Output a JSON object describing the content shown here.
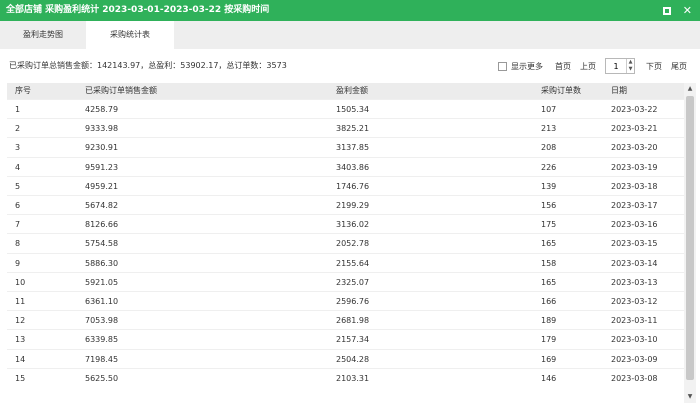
{
  "window": {
    "title": "全部店铺 采购盈利统计 2023-03-01-2023-03-22 按采购时间",
    "max_icon": "maximize-icon",
    "close_icon": "close-icon",
    "close_glyph": "✕"
  },
  "tabs": [
    {
      "label": "盈利走势图",
      "active": false
    },
    {
      "label": "采购统计表",
      "active": true
    }
  ],
  "summary": "已采购订单总销售金额：142143.97，总盈利：53902.17，总订单数：3573",
  "pager": {
    "show_more_label": "显示更多",
    "first_label": "首页",
    "prev_label": "上页",
    "page_value": "1",
    "next_label": "下页",
    "last_label": "尾页"
  },
  "table": {
    "columns": [
      "序号",
      "已采购订单销售金额",
      "盈利金额",
      "采购订单数",
      "日期"
    ],
    "rows": [
      [
        "1",
        "4258.79",
        "1505.34",
        "107",
        "2023-03-22"
      ],
      [
        "2",
        "9333.98",
        "3825.21",
        "213",
        "2023-03-21"
      ],
      [
        "3",
        "9230.91",
        "3137.85",
        "208",
        "2023-03-20"
      ],
      [
        "4",
        "9591.23",
        "3403.86",
        "226",
        "2023-03-19"
      ],
      [
        "5",
        "4959.21",
        "1746.76",
        "139",
        "2023-03-18"
      ],
      [
        "6",
        "5674.82",
        "2199.29",
        "156",
        "2023-03-17"
      ],
      [
        "7",
        "8126.66",
        "3136.02",
        "175",
        "2023-03-16"
      ],
      [
        "8",
        "5754.58",
        "2052.78",
        "165",
        "2023-03-15"
      ],
      [
        "9",
        "5886.30",
        "2155.64",
        "158",
        "2023-03-14"
      ],
      [
        "10",
        "5921.05",
        "2325.07",
        "165",
        "2023-03-13"
      ],
      [
        "11",
        "6361.10",
        "2596.76",
        "166",
        "2023-03-12"
      ],
      [
        "12",
        "7053.98",
        "2681.98",
        "189",
        "2023-03-11"
      ],
      [
        "13",
        "6339.85",
        "2157.34",
        "179",
        "2023-03-10"
      ],
      [
        "14",
        "7198.45",
        "2504.28",
        "169",
        "2023-03-09"
      ],
      [
        "15",
        "5625.50",
        "2103.31",
        "146",
        "2023-03-08"
      ]
    ]
  },
  "scrollbar": {
    "up_icon": "arrow-up-icon",
    "down_icon": "arrow-down-icon"
  }
}
